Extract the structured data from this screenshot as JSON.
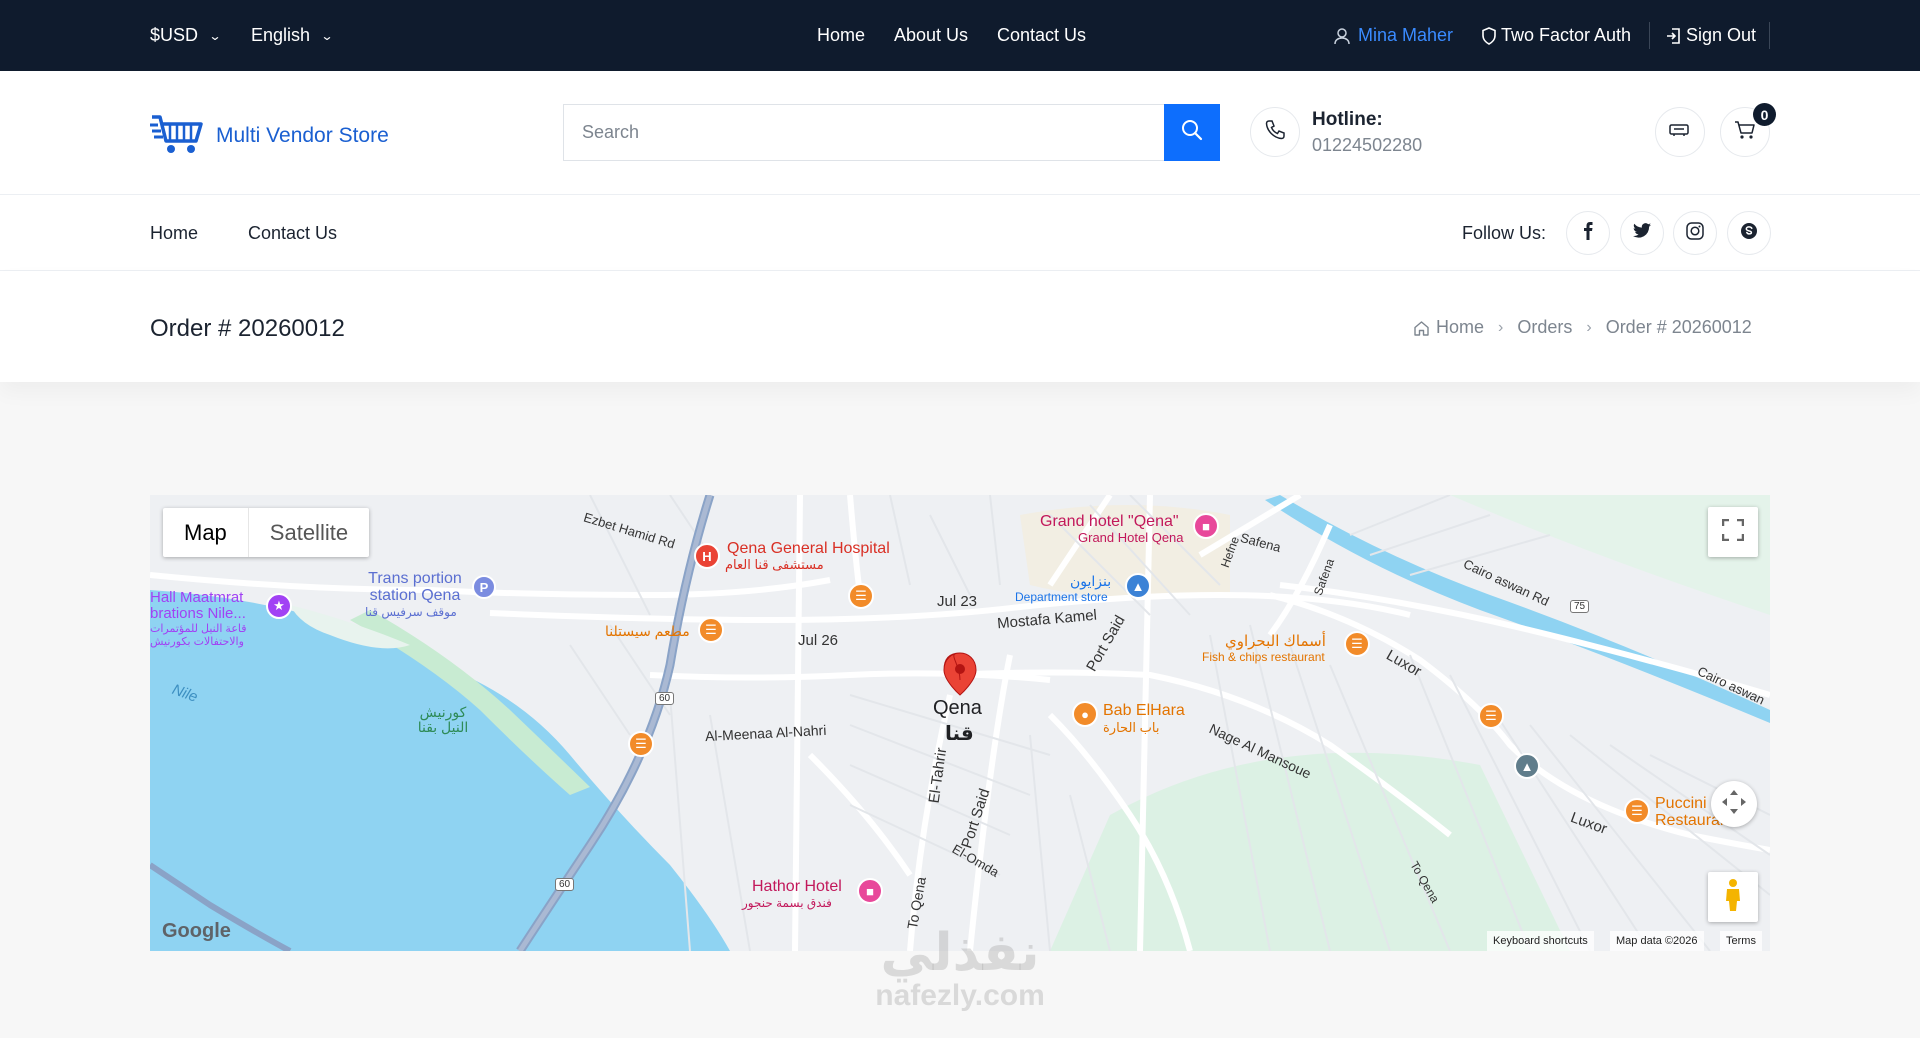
{
  "topbar": {
    "currency": "$USD",
    "language": "English",
    "nav": [
      "Home",
      "About Us",
      "Contact Us"
    ],
    "user_name": "Mina Maher",
    "two_factor": "Two Factor Auth",
    "sign_out": "Sign Out"
  },
  "header": {
    "logo_text": "Multi Vendor Store",
    "search_placeholder": "Search",
    "hotline_label": "Hotline:",
    "hotline_number": "01224502280",
    "cart_count": "0"
  },
  "nav": {
    "links": [
      "Home",
      "Contact Us"
    ],
    "follow_label": "Follow Us:",
    "social_icons": [
      "facebook-icon",
      "twitter-icon",
      "instagram-icon",
      "skype-icon"
    ]
  },
  "page": {
    "title": "Order # 20260012",
    "breadcrumbs": [
      "Home",
      "Orders",
      "Order # 20260012"
    ]
  },
  "map": {
    "type_options": [
      "Map",
      "Satellite"
    ],
    "selected_type": "Map",
    "labels": {
      "hospital_en": "Qena General Hospital",
      "hospital_ar": "مستشفى قنا العام",
      "grand_hotel": "Grand hotel \"Qena\"",
      "grand_hotel_sub": "Grand Hotel Qena",
      "trans_station": "Trans portion station Qena",
      "trans_station_ar": "موقف سرفيس قنا",
      "hall": "Hall Maatmrat brations Nile...",
      "hall_ar": "قاعة النيل للمؤتمرات والاحتفالات بكورنيش",
      "nile": "Nile",
      "corniche_ar": "كورنيش النيل بقنا",
      "restaurant_ar": "مطعم سيستلنا",
      "jul23": "Jul 23",
      "jul26": "Jul 26",
      "mostafa": "Mostafa Kamel",
      "bazaar_ar": "بنزايون",
      "dept_store": "Department store",
      "fish_ar": "أسماك البحراوي",
      "fish_en": "Fish & chips restaurant",
      "city_en": "Qena",
      "city_ar": "قنا",
      "bab": "Bab ElHara",
      "bab_ar": "باب الحارة",
      "meenaa": "Al-Meenaa Al-Nahri",
      "nage": "Nage Al Mansoue",
      "hathor": "Hathor Hotel",
      "hathor_ar": "فندق بسمة حنجور",
      "luxor": "Luxor",
      "cairo_aswan": "Cairo aswan Rd",
      "cairo_aswan2": "Cairo aswan",
      "puccini": "Puccini Restaurant",
      "port_said": "Port Said",
      "eltahrir": "El-Tahrir",
      "elomda": "El-Omda",
      "to_qena": "To Qena",
      "ezbet": "Ezbet Hamid Rd",
      "safena": "Safena",
      "hefne": "Hefne",
      "road60": "60",
      "road75": "75",
      "google": "Google"
    },
    "footer": {
      "shortcuts": "Keyboard shortcuts",
      "data": "Map data ©2026",
      "terms": "Terms"
    }
  },
  "watermark": {
    "ar": "نفذلي",
    "en": "nafezly.com"
  }
}
